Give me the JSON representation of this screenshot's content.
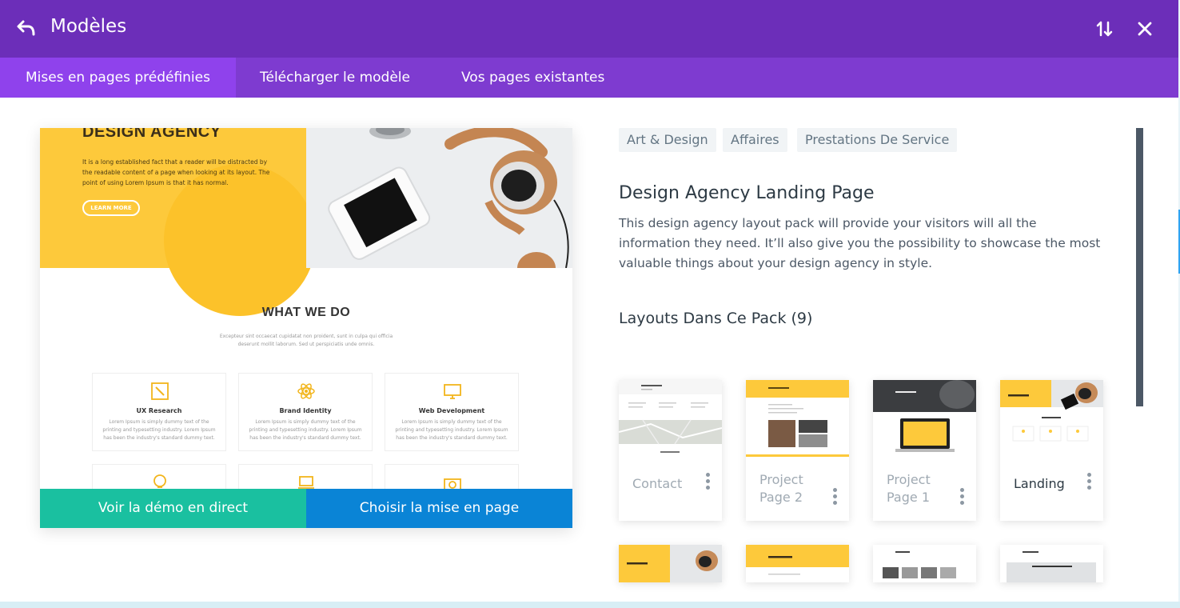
{
  "header": {
    "title": "Modèles",
    "back_icon": "back-arrow-icon",
    "sort_icon": "sort-icon",
    "close_icon": "close-icon"
  },
  "tabs": [
    {
      "label": "Mises en pages prédéfinies",
      "active": true
    },
    {
      "label": "Télécharger le modèle",
      "active": false
    },
    {
      "label": "Vos pages existantes",
      "active": false
    }
  ],
  "preview": {
    "heading": "DESIGN AGENCY",
    "intro": "It is a long established fact that a reader will be distracted by the readable content of a page when looking at its layout. The point of using Lorem Ipsum is that it has normal.",
    "learn_more": "LEARN MORE",
    "section_title": "WHAT WE DO",
    "section_sub": "Excepteur sint occaecat cupidatat non proident, sunt in culpa qui officia deserunt mollit laborum. Sed ut perspiciatis unde omnis.",
    "services": [
      {
        "name": "UX Research",
        "desc": "Lorem Ipsum is simply dummy text of the printing and typesetting industry. Lorem Ipsum has been the industry's standard dummy text.",
        "icon": "pencil-square-icon"
      },
      {
        "name": "Brand Identity",
        "desc": "Lorem Ipsum is simply dummy text of the printing and typesetting industry. Lorem Ipsum has been the industry's standard dummy text.",
        "icon": "atom-icon"
      },
      {
        "name": "Web Development",
        "desc": "Lorem Ipsum is simply dummy text of the printing and typesetting industry. Lorem Ipsum has been the industry's standard dummy text.",
        "icon": "monitor-icon"
      }
    ],
    "demo_button": "Voir la démo en direct",
    "choose_button": "Choisir la mise en page"
  },
  "tags": [
    "Art & Design",
    "Affaires",
    "Prestations De Service"
  ],
  "layout_pack": {
    "title": "Design Agency Landing Page",
    "description": "This design agency layout pack will provide your visitors will all the information they need. It’ll also give you the possibility to showcase the most valuable things about your design agency in style.",
    "layouts_heading": "Layouts Dans Ce Pack (9)"
  },
  "layouts": [
    {
      "label": "Contact"
    },
    {
      "label": "Project Page 2"
    },
    {
      "label": "Project Page 1"
    },
    {
      "label": "Landing"
    }
  ],
  "colors": {
    "titlebar": "#6c2eb9",
    "tabbar": "#7e3bd0",
    "tab_active": "#8f42ec",
    "demo_button": "#1ac0a0",
    "choose_button": "#0a84d6",
    "accent_yellow": "#fdc93b"
  }
}
